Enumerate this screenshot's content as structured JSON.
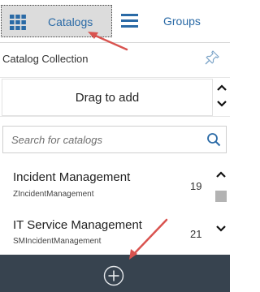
{
  "tabs": {
    "catalogs_label": "Catalogs",
    "groups_label": "Groups"
  },
  "collection": {
    "title": "Catalog Collection",
    "drag_label": "Drag to add"
  },
  "search": {
    "placeholder": "Search for catalogs",
    "value": ""
  },
  "catalogs": [
    {
      "title": "Incident Management",
      "id": "ZIncidentManagement",
      "count": "19"
    },
    {
      "title": "IT Service Management",
      "id": "SMIncidentManagement",
      "count": "21"
    }
  ],
  "colors": {
    "accent": "#2a6aa6",
    "bottom_bar": "#37434f",
    "annotation": "#d9534f",
    "selected_tab": "#dcdcdc"
  },
  "icons": [
    "grid-icon",
    "hamburger-icon",
    "pin-icon",
    "search-icon",
    "chevron-up-icon",
    "chevron-down-icon",
    "add-circle-icon"
  ]
}
